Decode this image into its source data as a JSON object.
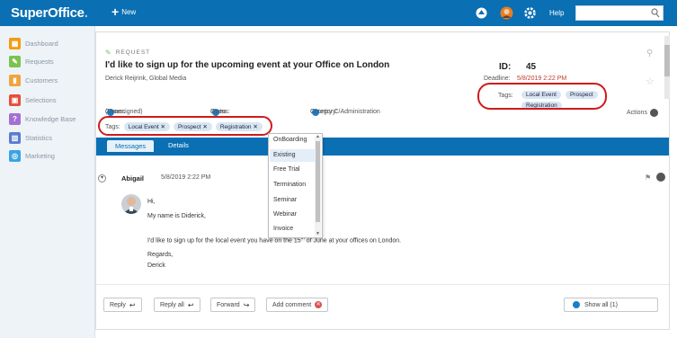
{
  "app": {
    "logo_main": "SuperOffice",
    "logo_dot": ".",
    "new_label": "New",
    "help_label": "Help",
    "search_placeholder": ""
  },
  "sidebar": {
    "items": [
      {
        "label": "Dashboard",
        "icon": "dashboard-icon",
        "color": "#f39c12"
      },
      {
        "label": "Requests",
        "icon": "requests-icon",
        "color": "#7cc24e"
      },
      {
        "label": "Customers",
        "icon": "customers-icon",
        "color": "#f0a53c"
      },
      {
        "label": "Selections",
        "icon": "selections-icon",
        "color": "#e74c3c"
      },
      {
        "label": "Knowledge Base",
        "icon": "knowledge-base-icon",
        "color": "#a56fd3"
      },
      {
        "label": "Statistics",
        "icon": "statistics-icon",
        "color": "#5b7bd1"
      },
      {
        "label": "Marketing",
        "icon": "marketing-icon",
        "color": "#3aa3e3"
      }
    ]
  },
  "request": {
    "type_label": "REQUEST",
    "title": "I'd like to sign up for the upcoming event at your Office on London",
    "contact": "Derick Reijrink, Global Media",
    "id_label": "ID:",
    "id_value": "45",
    "deadline_label": "Deadline:",
    "deadline_value": "5/8/2019 2:22 PM",
    "tags_label": "Tags:",
    "tags": [
      "Local Event",
      "Prospect",
      "Registration"
    ],
    "owner_label": "Owner:",
    "owner_value": "(Unassigned)",
    "status_label": "Status:",
    "status_value": "Open",
    "category_label": "Category:",
    "category_value": "Country C/Administration",
    "actions_label": "Actions",
    "edit_tags_label": "Tags:",
    "edit_tags": [
      "Local Event ✕",
      "Prospect ✕",
      "Registration ✕"
    ]
  },
  "tabs": [
    {
      "label": "Messages",
      "active": true
    },
    {
      "label": "Details",
      "active": false
    }
  ],
  "dropdown": {
    "options": [
      "OnBoarding",
      "Existing",
      "Free Trial",
      "Termination",
      "Seminar",
      "Webinar",
      "Invoice"
    ],
    "highlighted": "Existing"
  },
  "message": {
    "author": "Abigail",
    "date": "5/8/2019 2:22 PM",
    "greeting": "Hi,",
    "line1": "My name is Diderick,",
    "line2_pre": "I'd like to sign up for the local event you have on the 15",
    "line2_sup": "th",
    "line2_post": " of June at your offices on London.",
    "sign1": "Regards,",
    "sign2": "Derick"
  },
  "buttons": {
    "reply": "Reply",
    "reply_all": "Reply all",
    "forward": "Forward",
    "add_comment": "Add comment",
    "show_all": "Show all (1)"
  },
  "colors": {
    "brand": "#0a6fb3",
    "highlight_oval": "#d01a1a",
    "deadline": "#c0392b"
  }
}
